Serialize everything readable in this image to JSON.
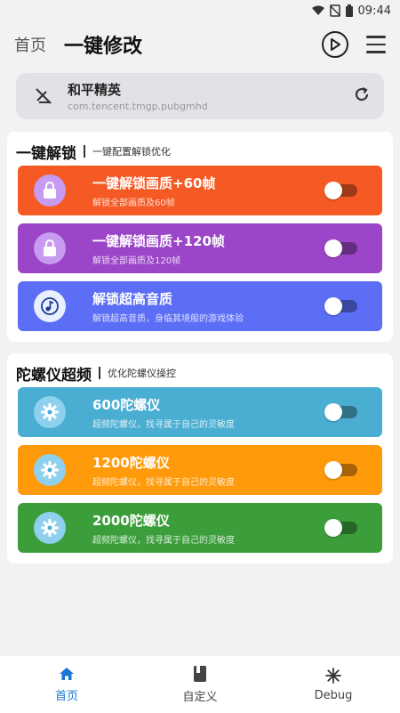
{
  "status": {
    "time": "09:44"
  },
  "topbar": {
    "home_label": "首页",
    "title": "一键修改"
  },
  "app": {
    "name": "和平精英",
    "package": "com.tencent.tmgp.pubgmhd"
  },
  "sections": [
    {
      "title": "一键解锁",
      "subtitle": "一键配置解锁优化",
      "items": [
        {
          "title": "一键解锁画质+60帧",
          "sub": "解锁全部画质及60帧",
          "color": "#f55a24",
          "icon": "lock-icon"
        },
        {
          "title": "一键解锁画质+120帧",
          "sub": "解锁全部画质及120帧",
          "color": "#9b45c8",
          "icon": "lock-icon"
        },
        {
          "title": "解锁超高音质",
          "sub": "解锁超高音质，身临其境般的游戏体验",
          "color": "#5b6ef5",
          "icon": "music-note-icon"
        }
      ]
    },
    {
      "title": "陀螺仪超频",
      "subtitle": "优化陀螺仪操控",
      "items": [
        {
          "title": "600陀螺仪",
          "sub": "超频陀螺仪，找寻属于自己的灵敏度",
          "color": "#4aaed2",
          "icon": "gear-icon"
        },
        {
          "title": "1200陀螺仪",
          "sub": "超频陀螺仪，找寻属于自己的灵敏度",
          "color": "#ff9a0a",
          "icon": "gear-icon"
        },
        {
          "title": "2000陀螺仪",
          "sub": "超频陀螺仪，找寻属于自己的灵敏度",
          "color": "#3b9e3b",
          "icon": "gear-icon"
        }
      ]
    }
  ],
  "bottomnav": [
    {
      "label": "首页",
      "icon": "home-icon",
      "active": true
    },
    {
      "label": "自定义",
      "icon": "book-icon",
      "active": false
    },
    {
      "label": "Debug",
      "icon": "snowflake-icon",
      "active": false
    }
  ]
}
